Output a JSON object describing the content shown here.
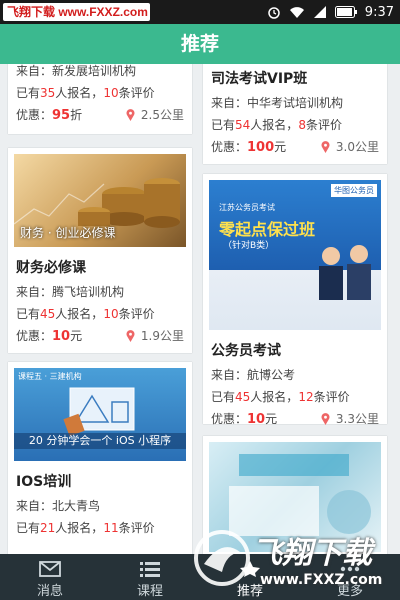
{
  "status": {
    "watermark": "飞翔下载 www.FXXZ.com",
    "time": "9:37"
  },
  "header": {
    "title": "推荐"
  },
  "labels": {
    "from": "来自：",
    "enrolled_pre": "已有",
    "enrolled_post": "人报名，",
    "reviews_post": "条评价",
    "discount": "优惠："
  },
  "cards_left": [
    {
      "title": "",
      "source": "新发展培训机构",
      "enrolled": "35",
      "reviews": "10",
      "price": "95",
      "price_unit": "折",
      "distance": "2.5公里"
    },
    {
      "title": "财务必修课",
      "image_caption": "财务 · 创业必修课",
      "source": "腾飞培训机构",
      "enrolled": "45",
      "reviews": "10",
      "price": "10",
      "price_unit": "元",
      "distance": "1.9公里"
    },
    {
      "title": "IOS培训",
      "image_caption": "20 分钟学会一个 iOS 小程序",
      "image_tag": "课程五 · 三建机构",
      "source": "北大青鸟",
      "enrolled": "21",
      "reviews": "11"
    }
  ],
  "cards_right": [
    {
      "title": "司法考试VIP班",
      "source": "中华考试培训机构",
      "enrolled": "54",
      "reviews": "8",
      "price": "100",
      "price_unit": "元",
      "distance": "3.0公里"
    },
    {
      "title": "公务员考试",
      "image_title": "零起点保过班",
      "image_sub": "（针对B类）",
      "image_badge": "华图公务员",
      "image_top": "江苏公务员考试",
      "source": "航博公考",
      "enrolled": "45",
      "reviews": "12",
      "price": "10",
      "price_unit": "元",
      "distance": "3.3公里"
    },
    {
      "title": ""
    }
  ],
  "nav": [
    {
      "label": "消息",
      "icon": "message-icon"
    },
    {
      "label": "课程",
      "icon": "list-icon"
    },
    {
      "label": "推荐",
      "icon": "recommend-icon"
    },
    {
      "label": "更多",
      "icon": "more-icon"
    }
  ],
  "watermark_bottom": {
    "text": "飞翔下载",
    "url": "www.FXXZ.com"
  },
  "colors": {
    "accent": "#3bb98f",
    "price": "#e33333",
    "nav_bg": "#263238"
  }
}
